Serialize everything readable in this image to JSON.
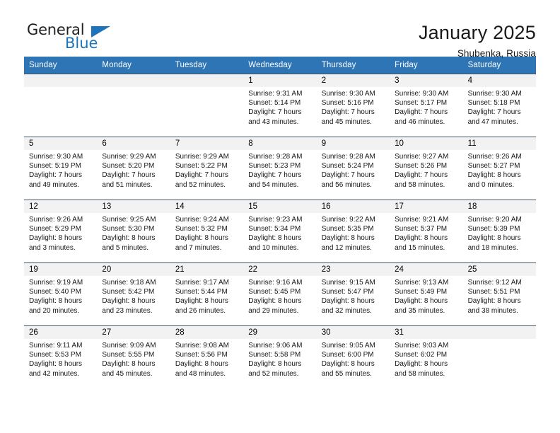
{
  "brand": {
    "name_top": "General",
    "name_bottom": "Blue",
    "triangle_color": "#1e74bb",
    "text_color": "#231f20"
  },
  "header": {
    "title": "January 2025",
    "subtitle": "Shubenka, Russia"
  },
  "theme": {
    "header_bar_color": "#2e75b6",
    "row_border_color": "#44546a",
    "day_band_color": "#f2f2f2",
    "page_background": "#ffffff"
  },
  "weekdays": [
    "Sunday",
    "Monday",
    "Tuesday",
    "Wednesday",
    "Thursday",
    "Friday",
    "Saturday"
  ],
  "weeks": [
    [
      {
        "day": "",
        "info": ""
      },
      {
        "day": "",
        "info": ""
      },
      {
        "day": "",
        "info": ""
      },
      {
        "day": "1",
        "info": "Sunrise: 9:31 AM\nSunset: 5:14 PM\nDaylight: 7 hours\nand 43 minutes."
      },
      {
        "day": "2",
        "info": "Sunrise: 9:30 AM\nSunset: 5:16 PM\nDaylight: 7 hours\nand 45 minutes."
      },
      {
        "day": "3",
        "info": "Sunrise: 9:30 AM\nSunset: 5:17 PM\nDaylight: 7 hours\nand 46 minutes."
      },
      {
        "day": "4",
        "info": "Sunrise: 9:30 AM\nSunset: 5:18 PM\nDaylight: 7 hours\nand 47 minutes."
      }
    ],
    [
      {
        "day": "5",
        "info": "Sunrise: 9:30 AM\nSunset: 5:19 PM\nDaylight: 7 hours\nand 49 minutes."
      },
      {
        "day": "6",
        "info": "Sunrise: 9:29 AM\nSunset: 5:20 PM\nDaylight: 7 hours\nand 51 minutes."
      },
      {
        "day": "7",
        "info": "Sunrise: 9:29 AM\nSunset: 5:22 PM\nDaylight: 7 hours\nand 52 minutes."
      },
      {
        "day": "8",
        "info": "Sunrise: 9:28 AM\nSunset: 5:23 PM\nDaylight: 7 hours\nand 54 minutes."
      },
      {
        "day": "9",
        "info": "Sunrise: 9:28 AM\nSunset: 5:24 PM\nDaylight: 7 hours\nand 56 minutes."
      },
      {
        "day": "10",
        "info": "Sunrise: 9:27 AM\nSunset: 5:26 PM\nDaylight: 7 hours\nand 58 minutes."
      },
      {
        "day": "11",
        "info": "Sunrise: 9:26 AM\nSunset: 5:27 PM\nDaylight: 8 hours\nand 0 minutes."
      }
    ],
    [
      {
        "day": "12",
        "info": "Sunrise: 9:26 AM\nSunset: 5:29 PM\nDaylight: 8 hours\nand 3 minutes."
      },
      {
        "day": "13",
        "info": "Sunrise: 9:25 AM\nSunset: 5:30 PM\nDaylight: 8 hours\nand 5 minutes."
      },
      {
        "day": "14",
        "info": "Sunrise: 9:24 AM\nSunset: 5:32 PM\nDaylight: 8 hours\nand 7 minutes."
      },
      {
        "day": "15",
        "info": "Sunrise: 9:23 AM\nSunset: 5:34 PM\nDaylight: 8 hours\nand 10 minutes."
      },
      {
        "day": "16",
        "info": "Sunrise: 9:22 AM\nSunset: 5:35 PM\nDaylight: 8 hours\nand 12 minutes."
      },
      {
        "day": "17",
        "info": "Sunrise: 9:21 AM\nSunset: 5:37 PM\nDaylight: 8 hours\nand 15 minutes."
      },
      {
        "day": "18",
        "info": "Sunrise: 9:20 AM\nSunset: 5:39 PM\nDaylight: 8 hours\nand 18 minutes."
      }
    ],
    [
      {
        "day": "19",
        "info": "Sunrise: 9:19 AM\nSunset: 5:40 PM\nDaylight: 8 hours\nand 20 minutes."
      },
      {
        "day": "20",
        "info": "Sunrise: 9:18 AM\nSunset: 5:42 PM\nDaylight: 8 hours\nand 23 minutes."
      },
      {
        "day": "21",
        "info": "Sunrise: 9:17 AM\nSunset: 5:44 PM\nDaylight: 8 hours\nand 26 minutes."
      },
      {
        "day": "22",
        "info": "Sunrise: 9:16 AM\nSunset: 5:45 PM\nDaylight: 8 hours\nand 29 minutes."
      },
      {
        "day": "23",
        "info": "Sunrise: 9:15 AM\nSunset: 5:47 PM\nDaylight: 8 hours\nand 32 minutes."
      },
      {
        "day": "24",
        "info": "Sunrise: 9:13 AM\nSunset: 5:49 PM\nDaylight: 8 hours\nand 35 minutes."
      },
      {
        "day": "25",
        "info": "Sunrise: 9:12 AM\nSunset: 5:51 PM\nDaylight: 8 hours\nand 38 minutes."
      }
    ],
    [
      {
        "day": "26",
        "info": "Sunrise: 9:11 AM\nSunset: 5:53 PM\nDaylight: 8 hours\nand 42 minutes."
      },
      {
        "day": "27",
        "info": "Sunrise: 9:09 AM\nSunset: 5:55 PM\nDaylight: 8 hours\nand 45 minutes."
      },
      {
        "day": "28",
        "info": "Sunrise: 9:08 AM\nSunset: 5:56 PM\nDaylight: 8 hours\nand 48 minutes."
      },
      {
        "day": "29",
        "info": "Sunrise: 9:06 AM\nSunset: 5:58 PM\nDaylight: 8 hours\nand 52 minutes."
      },
      {
        "day": "30",
        "info": "Sunrise: 9:05 AM\nSunset: 6:00 PM\nDaylight: 8 hours\nand 55 minutes."
      },
      {
        "day": "31",
        "info": "Sunrise: 9:03 AM\nSunset: 6:02 PM\nDaylight: 8 hours\nand 58 minutes."
      },
      {
        "day": "",
        "info": ""
      }
    ]
  ]
}
